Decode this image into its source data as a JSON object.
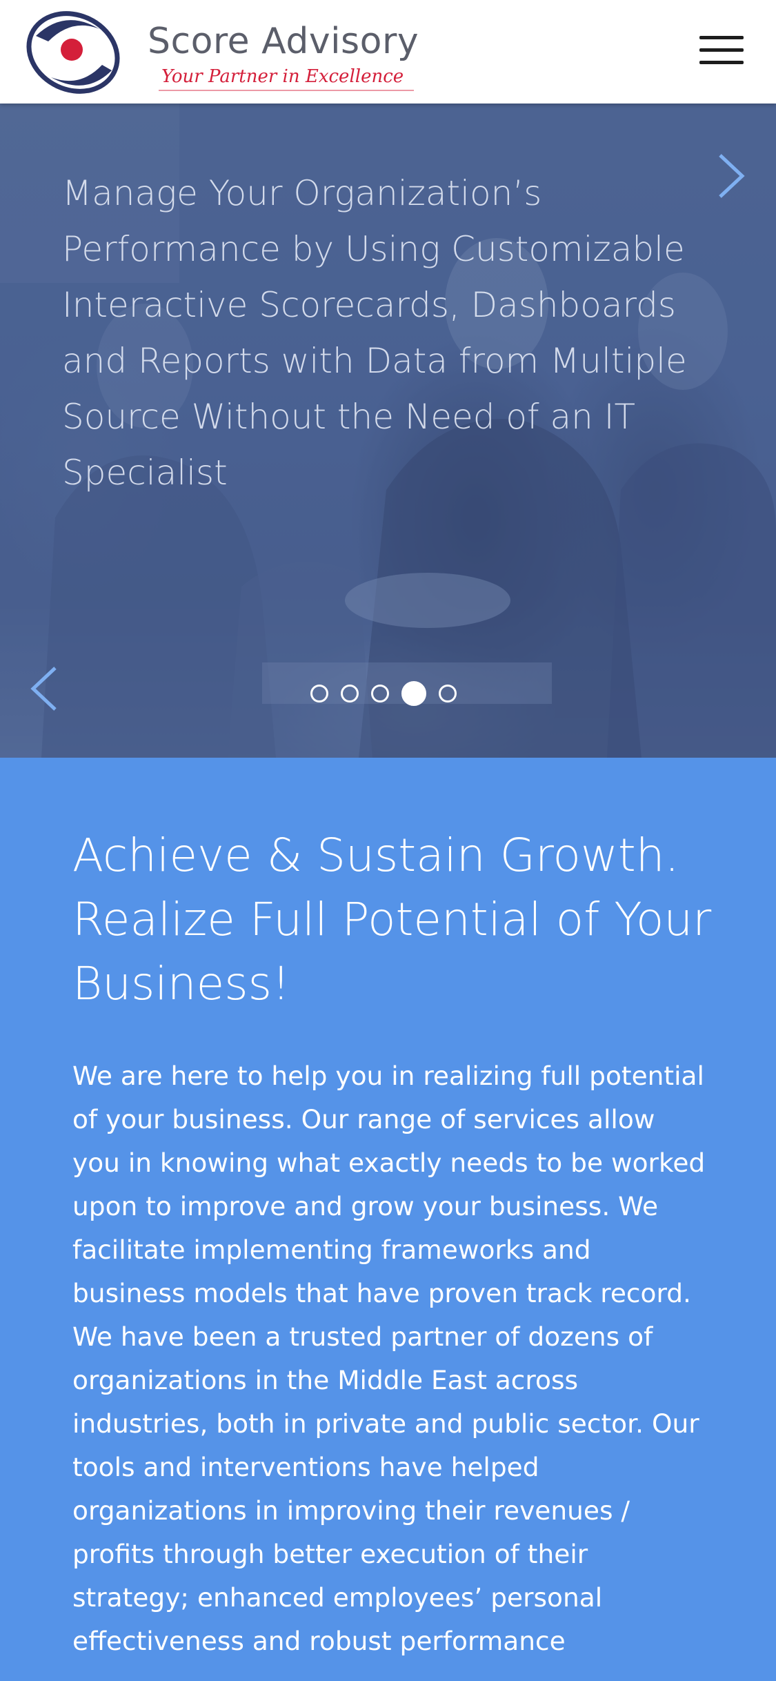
{
  "header": {
    "brand_name": "Score Advisory",
    "tagline": "Your Partner in Excellence",
    "logo_icon": "score-advisory-logo-icon",
    "menu_icon": "hamburger-menu-icon"
  },
  "hero": {
    "heading": "Manage Your Organization’s Performance by Using Customizable Interactive Scorecards, Dashboards and Reports with Data from Multiple Source Without the Need of an IT Specialist",
    "next_icon": "chevron-right-icon",
    "prev_icon": "chevron-left-icon",
    "slide_count": 5,
    "active_slide": 4
  },
  "about": {
    "heading": "Achieve & Sustain Growth. Realize Full Potential of Your Business!",
    "body": "We are here to help you in realizing full potential of your business. Our range of services allow you in knowing what exactly needs to be worked upon to improve and grow your business. We facilitate implementing frameworks and business models that have proven track record. We have been a trusted partner of dozens of organizations in the Middle East across industries, both in private and public sector. Our tools and interventions have helped organizations in improving their revenues / profits through better execution of their strategy; enhanced employees’ personal effectiveness and robust performance"
  },
  "colors": {
    "section_blue": "#5593e8",
    "brand_red": "#d41f3a",
    "brand_navy": "#2b3566",
    "arrow_blue": "#7fb0f2"
  }
}
